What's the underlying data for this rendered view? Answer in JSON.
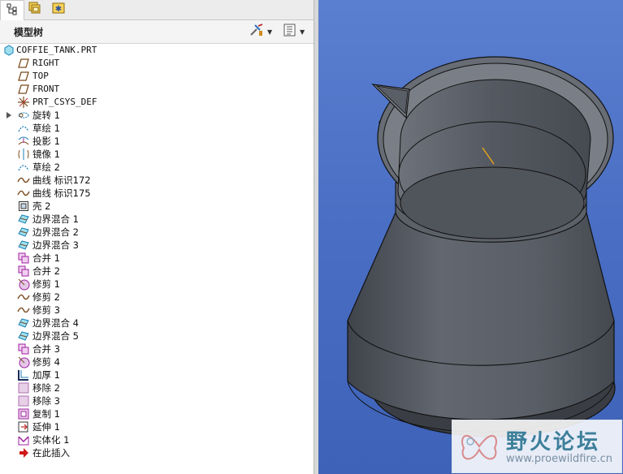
{
  "tabs": [
    {
      "name": "model-tree-tab",
      "icon": "tree-icon"
    },
    {
      "name": "folder-browser-tab",
      "icon": "folder-browser-icon"
    },
    {
      "name": "favorites-tab",
      "icon": "favorites-icon"
    }
  ],
  "header": {
    "title": "模型树",
    "settings_icon": "settings-tools-icon",
    "show_icon": "tree-columns-icon"
  },
  "tree": {
    "items": [
      {
        "label": "COFFIE_TANK.PRT",
        "icon": "part-icon"
      },
      {
        "label": "RIGHT",
        "icon": "datum-plane-icon"
      },
      {
        "label": "TOP",
        "icon": "datum-plane-icon"
      },
      {
        "label": "FRONT",
        "icon": "datum-plane-icon"
      },
      {
        "label": "PRT_CSYS_DEF",
        "icon": "csys-icon"
      },
      {
        "label": "旋转 1",
        "icon": "revolve-icon"
      },
      {
        "label": "草绘 1",
        "icon": "sketch-icon"
      },
      {
        "label": "投影 1",
        "icon": "project-icon"
      },
      {
        "label": "镜像 1",
        "icon": "mirror-icon"
      },
      {
        "label": "草绘 2",
        "icon": "sketch-icon"
      },
      {
        "label": "曲线 标识172",
        "icon": "curve-icon"
      },
      {
        "label": "曲线 标识175",
        "icon": "curve-icon"
      },
      {
        "label": "壳 2",
        "icon": "shell-icon"
      },
      {
        "label": "边界混合 1",
        "icon": "boundary-blend-icon"
      },
      {
        "label": "边界混合 2",
        "icon": "boundary-blend-icon"
      },
      {
        "label": "边界混合 3",
        "icon": "boundary-blend-icon"
      },
      {
        "label": "合并 1",
        "icon": "merge-icon"
      },
      {
        "label": "合并 2",
        "icon": "merge-icon"
      },
      {
        "label": "修剪 1",
        "icon": "trim-surface-icon"
      },
      {
        "label": "修剪 2",
        "icon": "trim-curve-icon"
      },
      {
        "label": "修剪 3",
        "icon": "trim-curve-icon"
      },
      {
        "label": "边界混合 4",
        "icon": "boundary-blend-icon"
      },
      {
        "label": "边界混合 5",
        "icon": "boundary-blend-icon"
      },
      {
        "label": "合并 3",
        "icon": "merge-icon"
      },
      {
        "label": "修剪 4",
        "icon": "trim-surface-icon"
      },
      {
        "label": "加厚 1",
        "icon": "thicken-icon"
      },
      {
        "label": "移除 2",
        "icon": "remove-icon"
      },
      {
        "label": "移除 3",
        "icon": "remove-icon"
      },
      {
        "label": "复制 1",
        "icon": "copy-icon"
      },
      {
        "label": "延伸 1",
        "icon": "extend-icon"
      },
      {
        "label": "实体化 1",
        "icon": "solidify-icon"
      },
      {
        "label": "在此插入",
        "icon": "insert-here-arrow-icon"
      }
    ]
  },
  "watermark": {
    "title": "野火论坛",
    "url": "www.proewildfire.cn"
  },
  "colors": {
    "viewport_background": "#4a6fc4",
    "model_shade": "#5a5e66",
    "icon_accent": "#1a7fb5",
    "curve_brown": "#7a4b1e"
  }
}
